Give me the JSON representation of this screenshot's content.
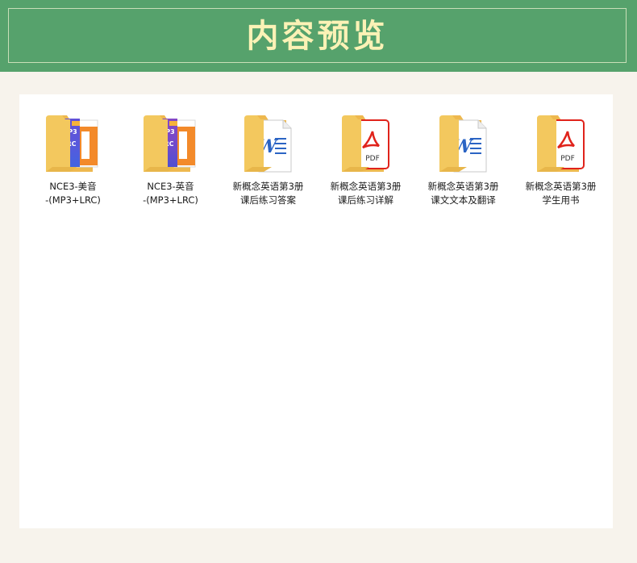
{
  "header": {
    "title": "内容预览"
  },
  "files": [
    {
      "line1": "NCE3-美音",
      "line2": "-(MP3+LRC)",
      "icon": "folder-mp3-lrc-icon"
    },
    {
      "line1": "NCE3-英音",
      "line2": "-(MP3+LRC)",
      "icon": "folder-mp3-lrc-icon"
    },
    {
      "line1": "新概念英语第3册",
      "line2": "课后练习答案",
      "icon": "folder-word-icon"
    },
    {
      "line1": "新概念英语第3册",
      "line2": "课后练习详解",
      "icon": "folder-pdf-icon"
    },
    {
      "line1": "新概念英语第3册",
      "line2": "课文文本及翻译",
      "icon": "folder-word-icon"
    },
    {
      "line1": "新概念英语第3册",
      "line2": "学生用书",
      "icon": "folder-pdf-icon"
    }
  ],
  "icon_text": {
    "mp3": "MP3",
    "lrc": "LRC",
    "pdf": "PDF",
    "word": "W"
  },
  "colors": {
    "banner": "#56a26c",
    "title": "#fbf2b6",
    "folder": "#f6d57c",
    "pdf_red": "#e0231b",
    "word_blue": "#2b64c4"
  }
}
